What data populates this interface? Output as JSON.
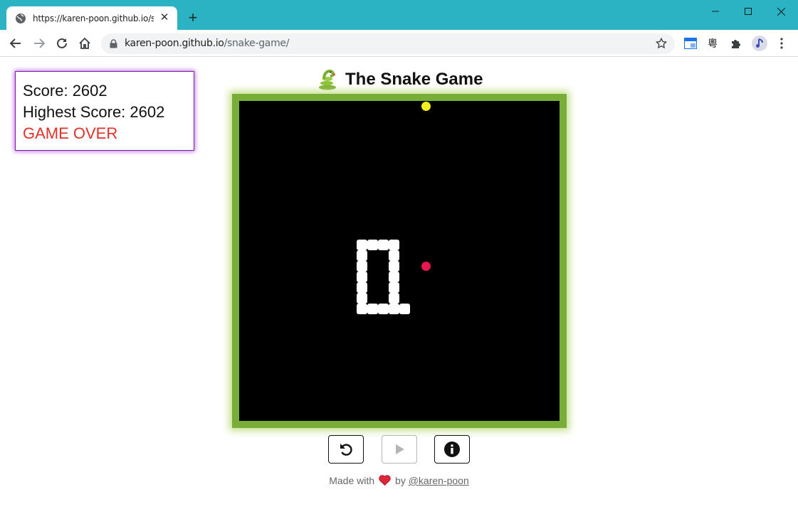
{
  "browser": {
    "tab_title": "https://karen-poon.github.io/snake-game/",
    "url_host": "karen-poon.github.io",
    "url_path": "/snake-game/"
  },
  "scoreboard": {
    "score_label": "Score: 2602",
    "highest_label": "Highest Score: 2602",
    "status": "GAME OVER"
  },
  "page": {
    "title": "The Snake Game"
  },
  "game": {
    "grid_size": 30,
    "snake_cells": [
      [
        11,
        13
      ],
      [
        12,
        13
      ],
      [
        13,
        13
      ],
      [
        14,
        13
      ],
      [
        11,
        14
      ],
      [
        14,
        14
      ],
      [
        11,
        15
      ],
      [
        14,
        15
      ],
      [
        11,
        16
      ],
      [
        14,
        16
      ],
      [
        11,
        17
      ],
      [
        14,
        17
      ],
      [
        11,
        18
      ],
      [
        14,
        18
      ],
      [
        11,
        19
      ],
      [
        12,
        19
      ],
      [
        13,
        19
      ],
      [
        14,
        19
      ],
      [
        15,
        19
      ]
    ],
    "food_red": [
      17,
      15
    ],
    "food_yellow": [
      17,
      0
    ],
    "colors": {
      "snake": "#ffffff",
      "food_red": "#e8174f",
      "food_yellow": "#f5ee1e",
      "board": "#000000",
      "frame": "#78ae38"
    }
  },
  "controls": {
    "restart_icon": "restart-icon",
    "play_icon": "play-icon",
    "info_icon": "info-icon"
  },
  "footer": {
    "made_with": "Made with",
    "by": "by",
    "author": "@karen-poon"
  }
}
